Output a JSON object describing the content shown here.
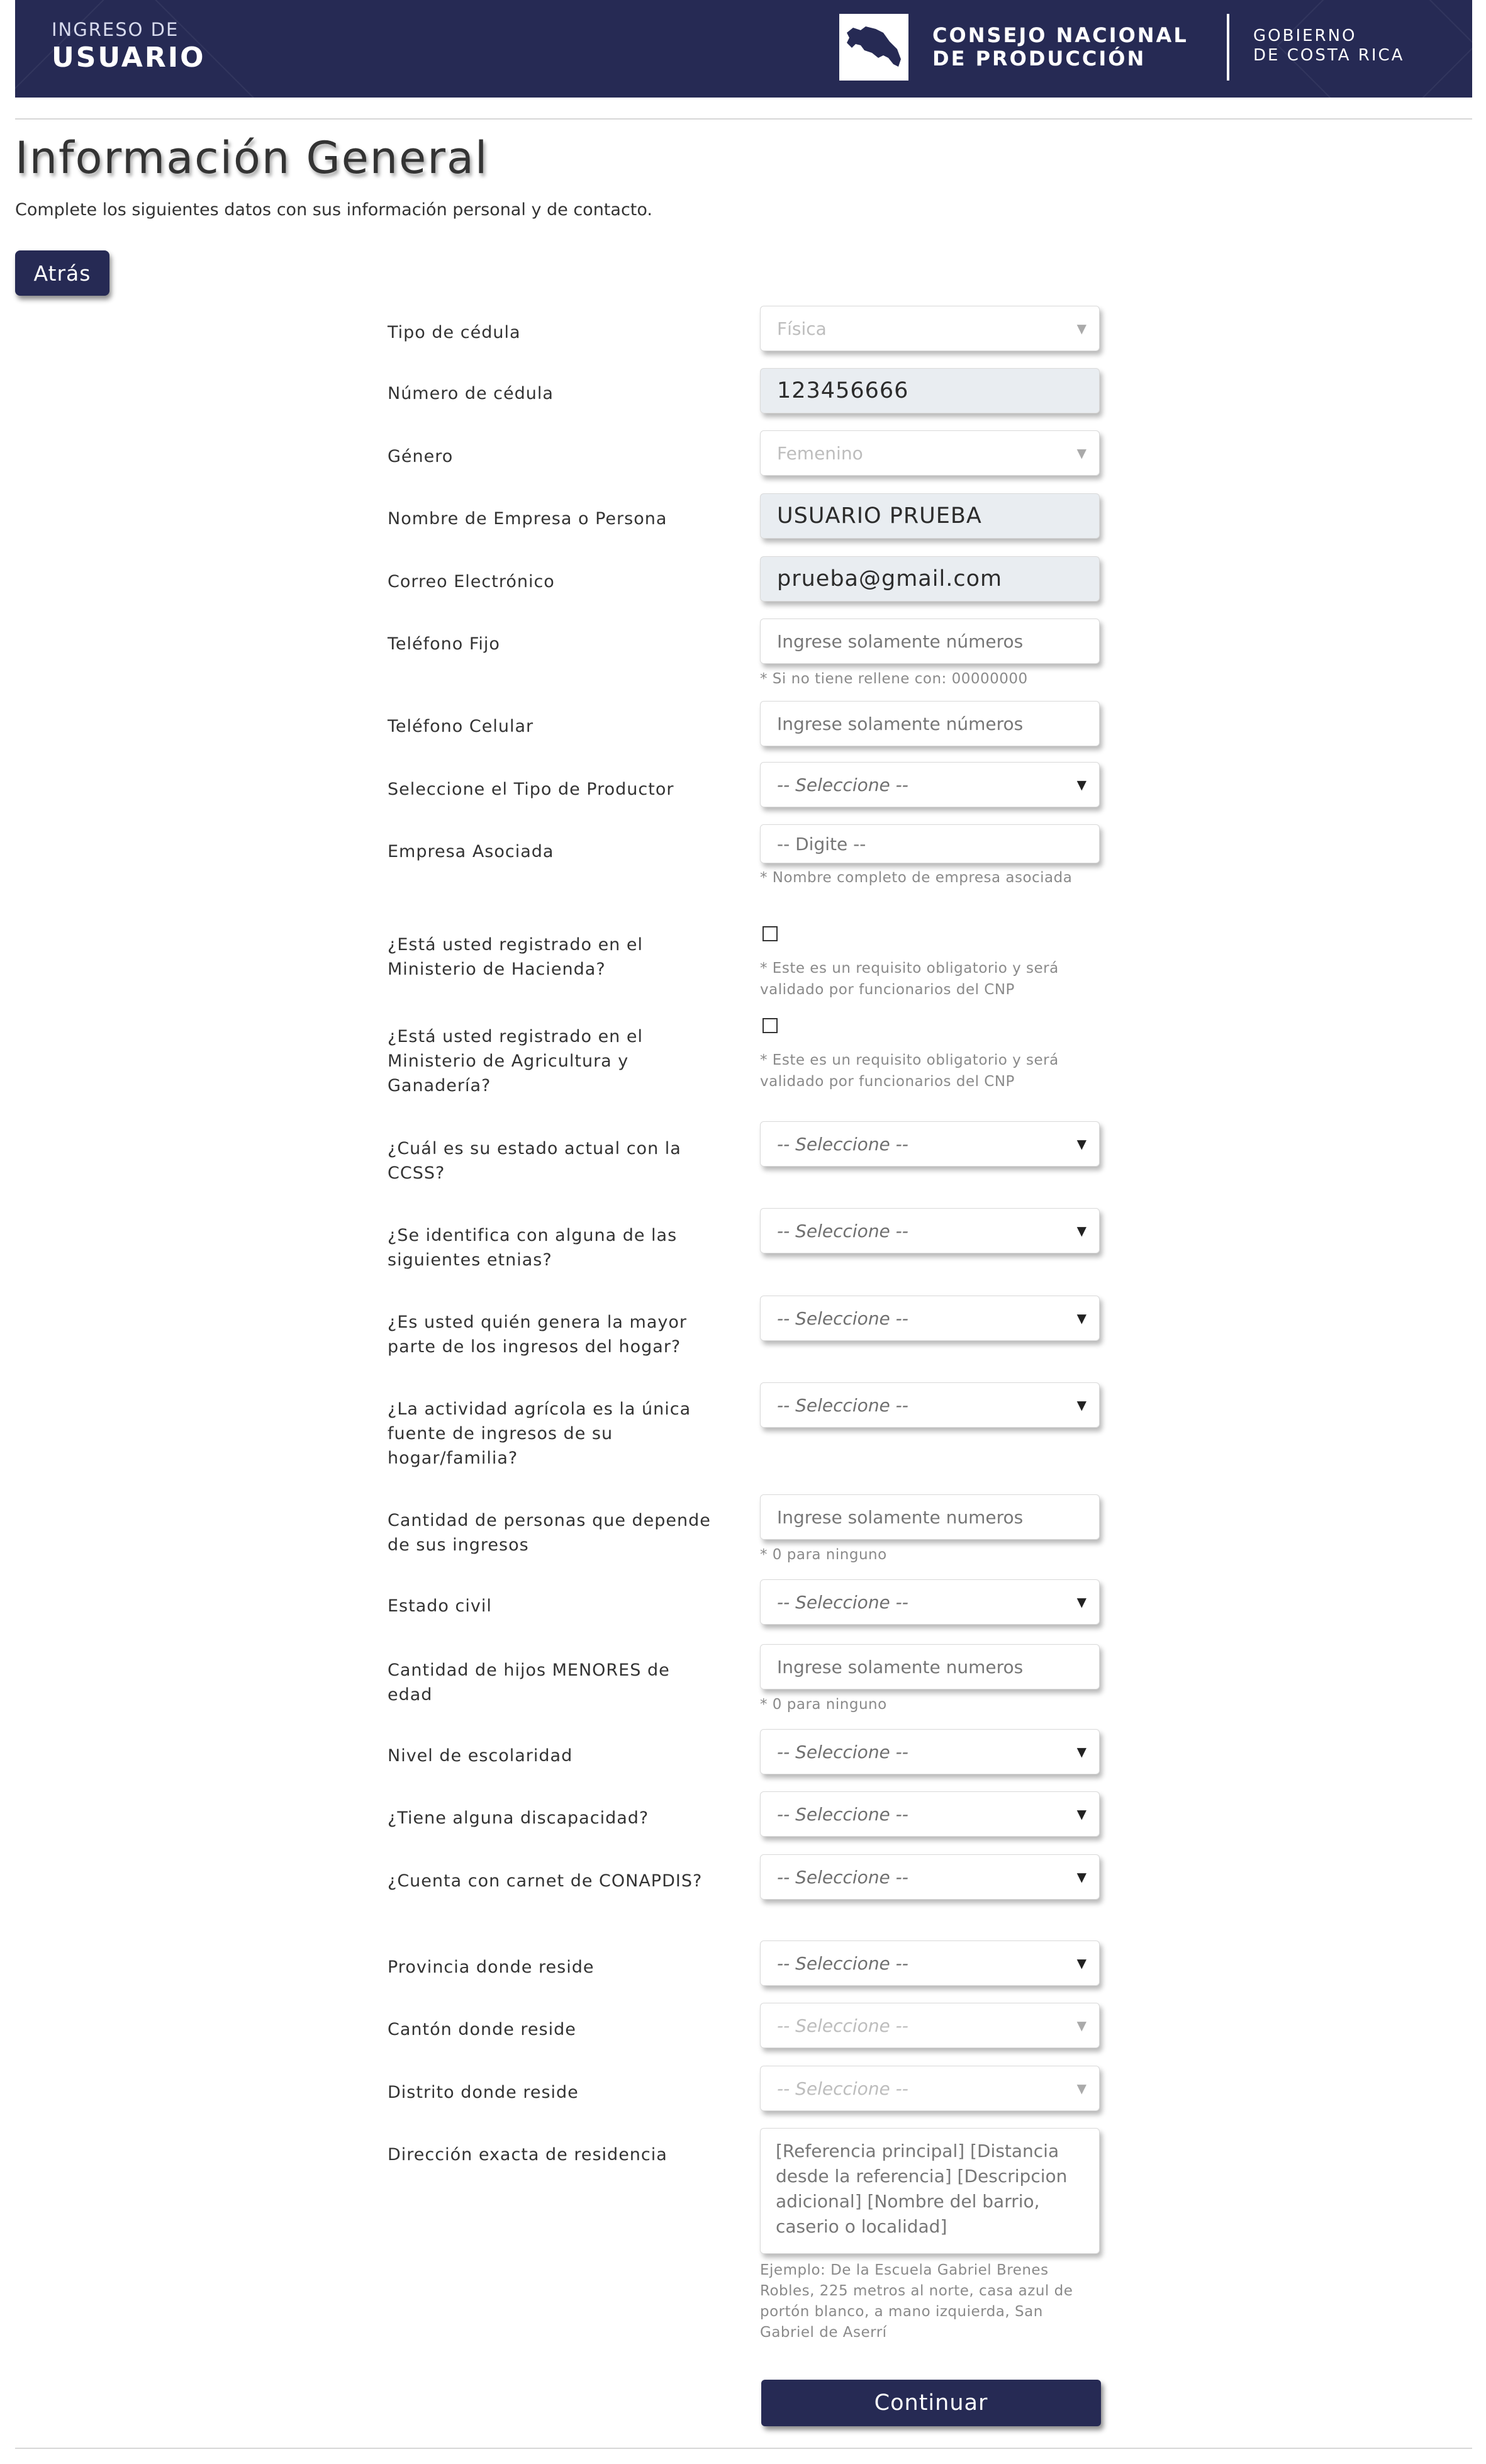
{
  "header": {
    "kicker": "INGRESO DE",
    "title": "USUARIO",
    "org_line1": "CONSEJO NACIONAL",
    "org_line2": "DE PRODUCCIÓN",
    "gov_line1": "GOBIERNO",
    "gov_line2": "DE COSTA RICA",
    "logo_icon": "costa-rica-map-icon"
  },
  "page": {
    "title": "Información General",
    "subtitle": "Complete los siguientes datos con sus información personal y de contacto.",
    "back_label": "Atrás"
  },
  "colors": {
    "primary": "#262a54",
    "readonly_bg": "#e9edf1",
    "help_text": "#8a8a8a"
  },
  "form": {
    "tipo_cedula": {
      "label": "Tipo de cédula",
      "value": "Física"
    },
    "numero_cedula": {
      "label": "Número de cédula",
      "value": "123456666"
    },
    "genero": {
      "label": "Género",
      "value": "Femenino"
    },
    "nombre": {
      "label": "Nombre de Empresa o Persona",
      "value": "USUARIO PRUEBA"
    },
    "correo": {
      "label": "Correo Electrónico",
      "value": "prueba@gmail.com"
    },
    "telefono_fijo": {
      "label": "Teléfono Fijo",
      "placeholder": "Ingrese solamente números",
      "help": "* Si no tiene rellene con: 00000000"
    },
    "telefono_celular": {
      "label": "Teléfono Celular",
      "placeholder": "Ingrese solamente números"
    },
    "tipo_productor": {
      "label": "Seleccione el Tipo de Productor",
      "value": "-- Seleccione --"
    },
    "empresa_asociada": {
      "label": "Empresa Asociada",
      "placeholder": "-- Digite --",
      "help": "* Nombre completo de empresa asociada"
    },
    "hacienda": {
      "label": "¿Está usted registrado en el Ministerio de Hacienda?",
      "help": "* Este es un requisito obligatorio y será validado por funcionarios del CNP"
    },
    "mag": {
      "label": "¿Está usted registrado en el Ministerio de Agricultura y Ganadería?",
      "help": "* Este es un requisito obligatorio y será validado por funcionarios del CNP"
    },
    "ccss": {
      "label": "¿Cuál es su estado actual con la CCSS?",
      "value": "-- Seleccione --"
    },
    "etnias": {
      "label": "¿Se identifica con alguna de las siguientes etnias?",
      "value": "-- Seleccione --"
    },
    "ingresos_hogar": {
      "label": "¿Es usted quién genera la mayor parte de los ingresos del hogar?",
      "value": "-- Seleccione --"
    },
    "actividad_agricola": {
      "label": "¿La actividad agrícola es la única fuente de ingresos de su hogar/familia?",
      "value": "-- Seleccione --"
    },
    "personas_dependen": {
      "label": "Cantidad de personas que depende de sus ingresos",
      "placeholder": "Ingrese solamente numeros",
      "help": "* 0 para ninguno"
    },
    "estado_civil": {
      "label": "Estado civil",
      "value": "-- Seleccione --"
    },
    "hijos_menores": {
      "label": "Cantidad de hijos MENORES de edad",
      "placeholder": "Ingrese solamente numeros",
      "help": "* 0 para ninguno"
    },
    "escolaridad": {
      "label": "Nivel de escolaridad",
      "value": "-- Seleccione --"
    },
    "discapacidad": {
      "label": "¿Tiene alguna discapacidad?",
      "value": "-- Seleccione --"
    },
    "conapdis": {
      "label": "¿Cuenta con carnet de CONAPDIS?",
      "value": "-- Seleccione --"
    },
    "provincia": {
      "label": "Provincia donde reside",
      "value": "-- Seleccione --"
    },
    "canton": {
      "label": "Cantón donde reside",
      "value": "-- Seleccione --"
    },
    "distrito": {
      "label": "Distrito donde reside",
      "value": "-- Seleccione --"
    },
    "direccion": {
      "label": "Dirección exacta de residencia",
      "placeholder": "[Referencia principal] [Distancia desde la referencia] [Descripcion adicional] [Nombre del barrio, caserio o localidad]",
      "help": "Ejemplo: De la Escuela Gabriel Brenes Robles, 225 metros al norte, casa azul de portón blanco, a mano izquierda, San Gabriel de Aserrí"
    }
  },
  "continue_label": "Continuar"
}
